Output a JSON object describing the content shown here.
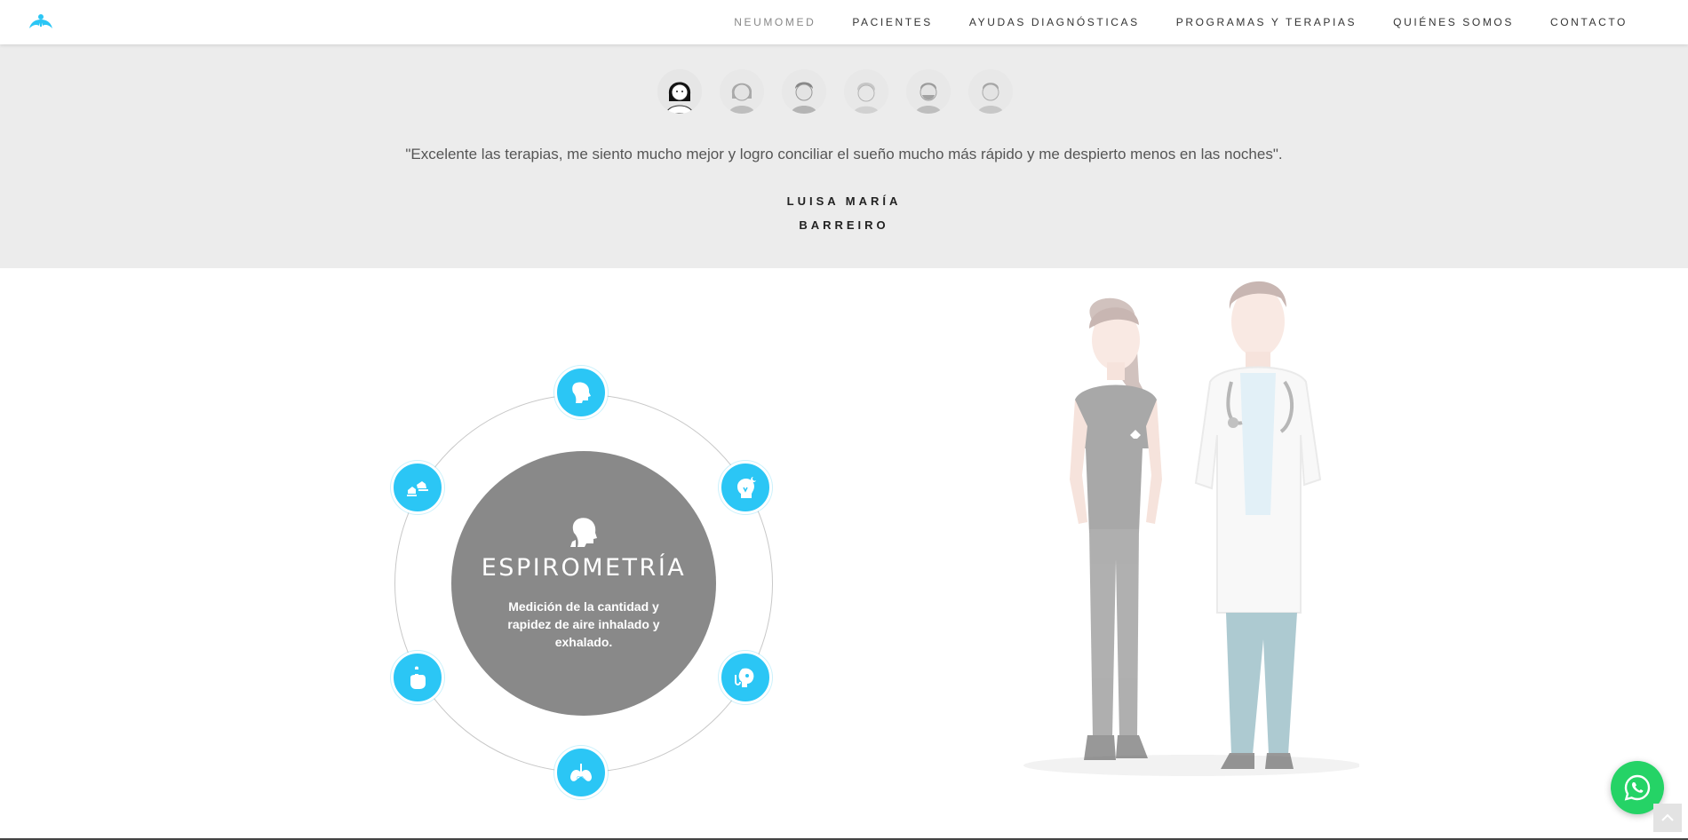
{
  "header": {
    "logo_icon": "neumomed-lungs-logo-icon",
    "nav": [
      {
        "label": "NEUMOMED",
        "active": true
      },
      {
        "label": "PACIENTES",
        "active": false
      },
      {
        "label": "AYUDAS DIAGNÓSTICAS",
        "active": false
      },
      {
        "label": "PROGRAMAS Y TERAPIAS",
        "active": false
      },
      {
        "label": "QUIÉNES SOMOS",
        "active": false
      },
      {
        "label": "CONTACTO",
        "active": false
      }
    ]
  },
  "testimonial": {
    "avatars": [
      {
        "icon": "woman-avatar-icon",
        "selected": true
      },
      {
        "icon": "woman-avatar-icon",
        "selected": false
      },
      {
        "icon": "man-avatar-icon",
        "selected": false
      },
      {
        "icon": "elderly-woman-avatar-icon",
        "selected": false
      },
      {
        "icon": "bearded-man-avatar-icon",
        "selected": false
      },
      {
        "icon": "man-avatar-icon",
        "selected": false
      }
    ],
    "quote": "\"Excelente las terapias, me siento mucho mejor y logro conciliar el sueño mucho más rápido y me despierto menos en las noches\".",
    "author_line1": "LUISA MARÍA",
    "author_line2": "BARREIRO"
  },
  "services": {
    "active": {
      "icon": "head-lungs-icon",
      "title": "ESPIROMETRÍA",
      "description": "Medición de la cantidad y rapidez de aire inhalado y exhalado."
    },
    "nodes": [
      {
        "icon": "head-profile-icon"
      },
      {
        "icon": "head-brain-sleep-icon"
      },
      {
        "icon": "stethoscope-head-icon"
      },
      {
        "icon": "lungs-co2-icon"
      },
      {
        "icon": "finger-oximeter-icon"
      },
      {
        "icon": "walking-feet-icon"
      }
    ]
  },
  "illustration": {
    "subject": "nurse-and-doctor-illustration"
  },
  "floating": {
    "whatsapp_icon": "whatsapp-icon",
    "scroll_top_icon": "chevron-up-icon"
  },
  "colors": {
    "accent": "#2bc6f5",
    "band": "#ececec",
    "center_disk": "#898989",
    "whatsapp": "#25d366"
  }
}
